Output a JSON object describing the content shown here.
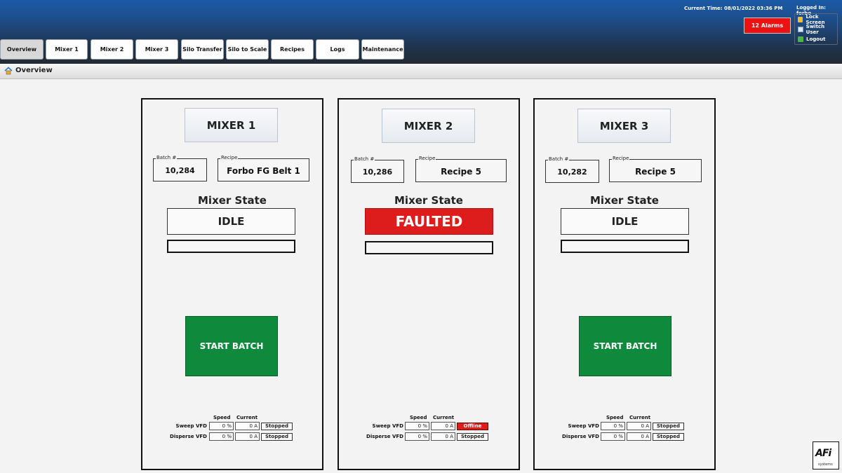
{
  "header": {
    "current_time": "Current Time: 08/01/2022 03:36 PM",
    "logged_in": "Logged In: forbo",
    "alarms_label": "12 Alarms",
    "alarm_color": "#ee1111",
    "user_menu": [
      {
        "label": "Lock Screen",
        "icon": "lock-icon"
      },
      {
        "label": "Switch User",
        "icon": "user-icon"
      },
      {
        "label": "Logout",
        "icon": "logout-icon"
      }
    ]
  },
  "tabs": [
    {
      "label": "Overview",
      "active": true
    },
    {
      "label": "Mixer 1"
    },
    {
      "label": "Mixer 2"
    },
    {
      "label": "Mixer 3"
    },
    {
      "label": "Silo Transfer"
    },
    {
      "label": "Silo to Scale"
    },
    {
      "label": "Recipes"
    },
    {
      "label": "Logs"
    },
    {
      "label": "Maintenance"
    }
  ],
  "breadcrumb": {
    "title": "Overview",
    "icon": "home-icon"
  },
  "mixers": [
    {
      "title": "MIXER 1",
      "batch_label": "Batch #",
      "batch": "10,284",
      "recipe_label": "Recipe",
      "recipe": "Forbo FG Belt 1",
      "state_label": "Mixer State",
      "state": "IDLE",
      "start_label": "START BATCH",
      "vfd": {
        "speed_header": "Speed",
        "current_header": "Current",
        "rows": [
          {
            "label": "Sweep VFD",
            "speed": "0 %",
            "current": "0 A",
            "status": "Stopped"
          },
          {
            "label": "Disperse VFD",
            "speed": "0 %",
            "current": "0 A",
            "status": "Stopped"
          }
        ]
      }
    },
    {
      "title": "MIXER 2",
      "batch_label": "Batch #",
      "batch": "10,286",
      "recipe_label": "Recipe",
      "recipe": "Recipe 5",
      "state_label": "Mixer State",
      "state": "FAULTED",
      "start_label": "",
      "vfd": {
        "speed_header": "Speed",
        "current_header": "Current",
        "rows": [
          {
            "label": "Sweep VFD",
            "speed": "0 %",
            "current": "0 A",
            "status": "Offline"
          },
          {
            "label": "Disperse VFD",
            "speed": "0 %",
            "current": "0 A",
            "status": "Stopped"
          }
        ]
      }
    },
    {
      "title": "MIXER 3",
      "batch_label": "Batch #",
      "batch": "10,282",
      "recipe_label": "Recipe",
      "recipe": "Recipe 5",
      "state_label": "Mixer State",
      "state": "IDLE",
      "start_label": "START BATCH",
      "vfd": {
        "speed_header": "Speed",
        "current_header": "Current",
        "rows": [
          {
            "label": "Sweep VFD",
            "speed": "0 %",
            "current": "0 A",
            "status": "Stopped"
          },
          {
            "label": "Disperse VFD",
            "speed": "0 %",
            "current": "0 A",
            "status": "Stopped"
          }
        ]
      }
    }
  ],
  "colors": {
    "faulted": "#dd1c1c",
    "start_button": "#0f8a3c"
  },
  "logo": {
    "text": "AFi",
    "sub": "systems"
  }
}
